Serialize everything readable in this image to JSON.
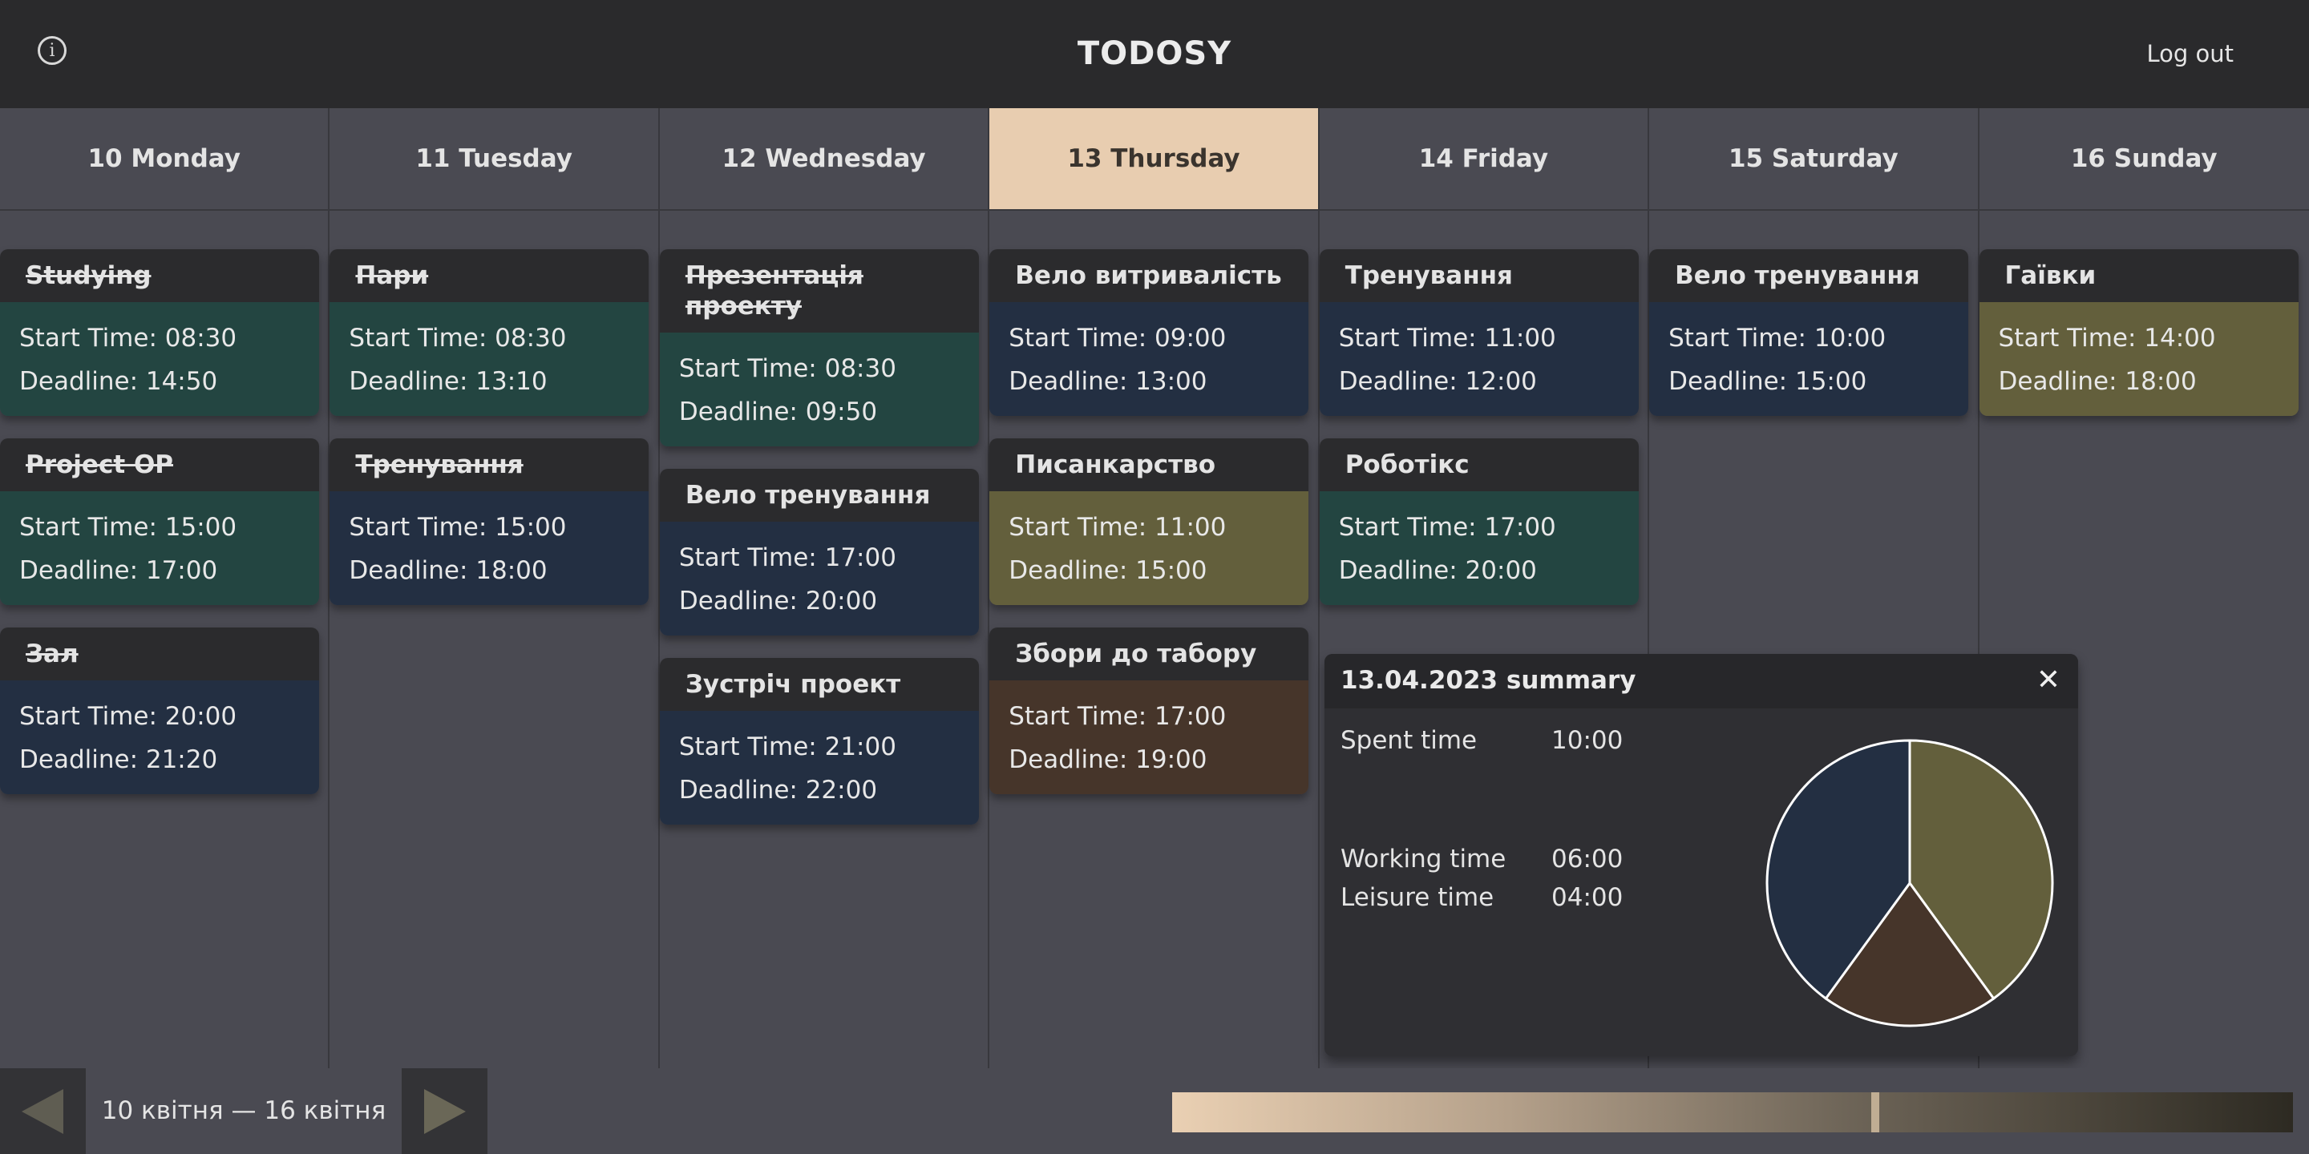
{
  "header": {
    "title": "TODOSY",
    "logout_label": "Log out",
    "info_icon": "info-icon"
  },
  "days": [
    {
      "label": "10 Monday",
      "today": false
    },
    {
      "label": "11 Tuesday",
      "today": false
    },
    {
      "label": "12 Wednesday",
      "today": false
    },
    {
      "label": "13 Thursday",
      "today": true
    },
    {
      "label": "14 Friday",
      "today": false
    },
    {
      "label": "15 Saturday",
      "today": false
    },
    {
      "label": "16 Sunday",
      "today": false
    }
  ],
  "colors": {
    "green": "#234541",
    "navy": "#232f42",
    "olive": "#635f3c",
    "brown": "#46352a",
    "today": "#e8cdb0"
  },
  "start_prefix": "Start Time: ",
  "deadline_prefix": "Deadline: ",
  "columns": [
    {
      "tasks": [
        {
          "title": "Studying",
          "start": "08:30",
          "deadline": "14:50",
          "color": "green",
          "done": true
        },
        {
          "title": "Project OP",
          "start": "15:00",
          "deadline": "17:00",
          "color": "green",
          "done": true
        },
        {
          "title": "Зал",
          "start": "20:00",
          "deadline": "21:20",
          "color": "navy",
          "done": true
        }
      ]
    },
    {
      "tasks": [
        {
          "title": "Пари",
          "start": "08:30",
          "deadline": "13:10",
          "color": "green",
          "done": true
        },
        {
          "title": "Тренування",
          "start": "15:00",
          "deadline": "18:00",
          "color": "navy",
          "done": true
        }
      ]
    },
    {
      "tasks": [
        {
          "title": "Презентація проекту",
          "start": "08:30",
          "deadline": "09:50",
          "color": "green",
          "done": true
        },
        {
          "title": "Вело тренування",
          "start": "17:00",
          "deadline": "20:00",
          "color": "navy",
          "done": false
        },
        {
          "title": "Зустріч проект",
          "start": "21:00",
          "deadline": "22:00",
          "color": "navy",
          "done": false
        }
      ]
    },
    {
      "tasks": [
        {
          "title": "Вело витривалість",
          "start": "09:00",
          "deadline": "13:00",
          "color": "navy",
          "done": false
        },
        {
          "title": "Писанкарство",
          "start": "11:00",
          "deadline": "15:00",
          "color": "olive",
          "done": false
        },
        {
          "title": "Збори до табору",
          "start": "17:00",
          "deadline": "19:00",
          "color": "brown",
          "done": false
        }
      ]
    },
    {
      "tasks": [
        {
          "title": "Тренування",
          "start": "11:00",
          "deadline": "12:00",
          "color": "navy",
          "done": false
        },
        {
          "title": "Роботікс",
          "start": "17:00",
          "deadline": "20:00",
          "color": "green",
          "done": false
        }
      ]
    },
    {
      "tasks": [
        {
          "title": "Вело тренування",
          "start": "10:00",
          "deadline": "15:00",
          "color": "navy",
          "done": false
        }
      ]
    },
    {
      "tasks": [
        {
          "title": "Гаївки",
          "start": "14:00",
          "deadline": "18:00",
          "color": "olive",
          "done": false
        }
      ]
    }
  ],
  "summary": {
    "title": "13.04.2023 summary",
    "close_icon": "close-icon",
    "spent_label": "Spent time",
    "spent_value": "10:00",
    "working_label": "Working time",
    "working_value": "06:00",
    "leisure_label": "Leisure time",
    "leisure_value": "04:00"
  },
  "chart_data": {
    "type": "pie",
    "slices": [
      {
        "value": 4,
        "color": "#635f3c"
      },
      {
        "value": 2,
        "color": "#46352a"
      },
      {
        "value": 4,
        "color": "#232f42"
      }
    ]
  },
  "footer": {
    "range_label": "10 квітня — 16 квітня",
    "prev_icon": "arrow-left-icon",
    "next_icon": "arrow-right-icon",
    "progress_fraction": 0.627
  }
}
